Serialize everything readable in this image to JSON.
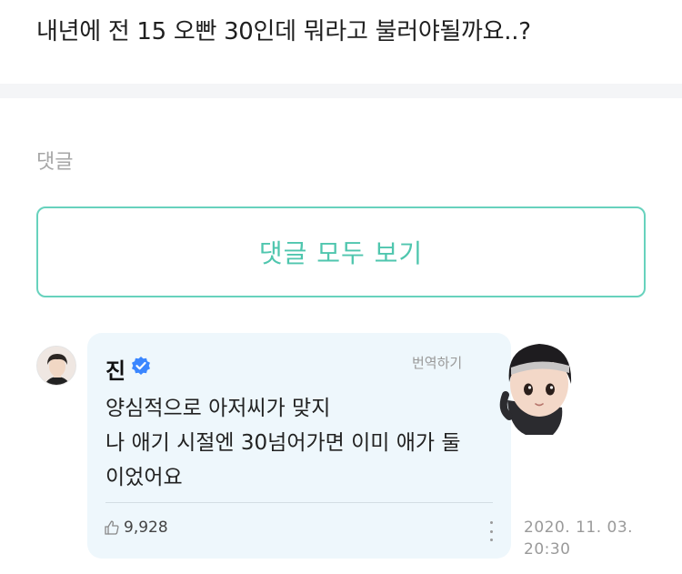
{
  "post": {
    "title": "내년에 전 15 오빤 30인데 뭐라고 불러야될까요..?"
  },
  "comments_section": {
    "label": "댓글",
    "view_all_label": "댓글 모두 보기"
  },
  "comment": {
    "author": "진",
    "verified_icon": "verified-badge-icon",
    "translate_label": "번역하기",
    "lines": [
      "양심적으로 아저씨가 맞지",
      "나 애기 시절엔 30넘어가면 이미 애가 둘",
      "이었어요"
    ],
    "likes": "9,928",
    "like_icon": "thumbs-up-icon",
    "more_icon": "more-vertical-icon",
    "date": "2020. 11. 03.",
    "time": "20:30"
  },
  "colors": {
    "accent": "#4fc6ae",
    "bubble": "#eef7fc",
    "verified": "#3a86ff"
  }
}
